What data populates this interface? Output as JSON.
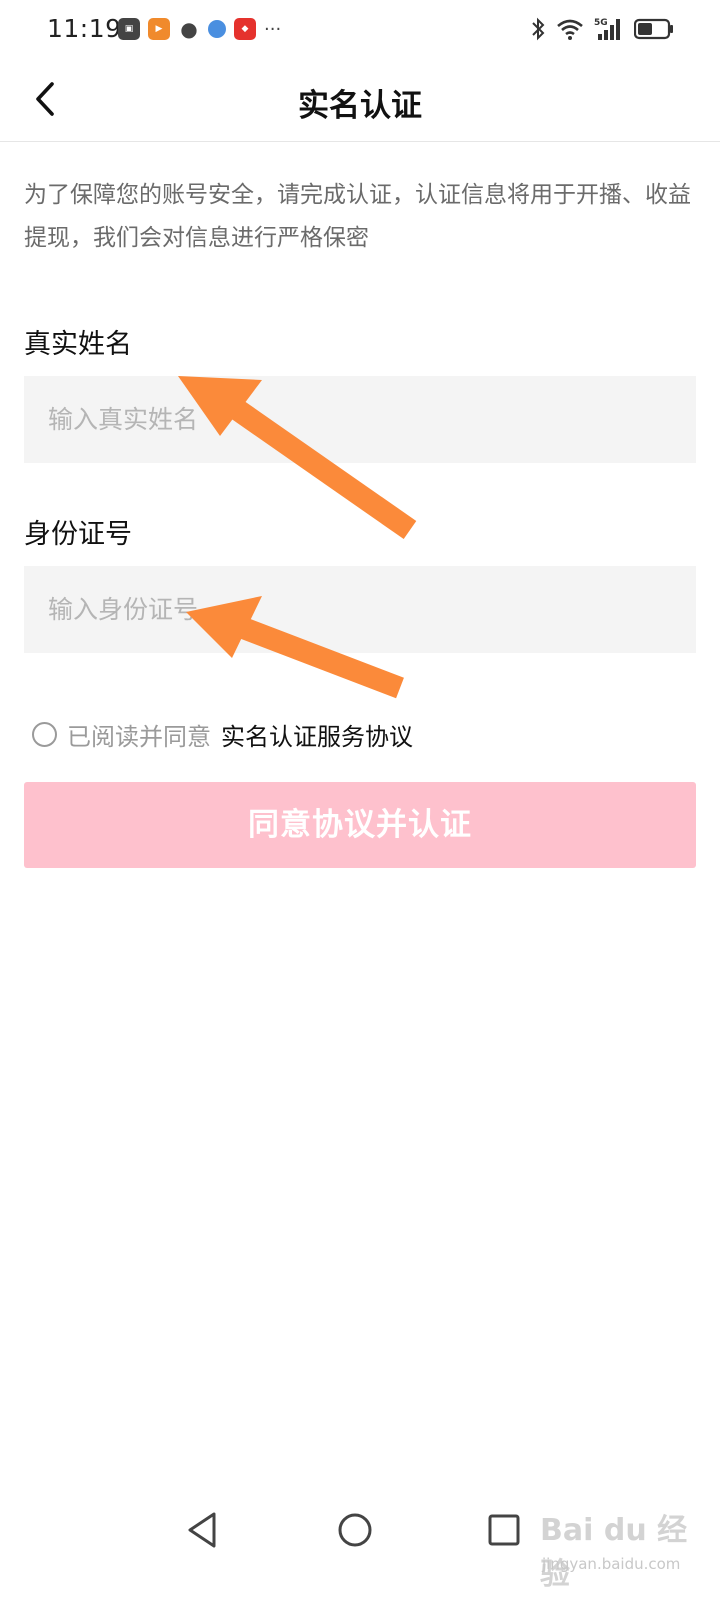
{
  "status_bar": {
    "time": "11:19",
    "more": "···",
    "network": "5G"
  },
  "header": {
    "title": "实名认证"
  },
  "intro_text": "为了保障您的账号安全，请完成认证，认证信息将用于开播、收益提现，我们会对信息进行严格保密",
  "form": {
    "name_label": "真实姓名",
    "name_placeholder": "输入真实姓名",
    "id_label": "身份证号",
    "id_placeholder": "输入身份证号"
  },
  "agreement": {
    "prefix": "已阅读并同意",
    "link": "实名认证服务协议",
    "checked": false
  },
  "submit_label": "同意协议并认证",
  "colors": {
    "submit_bg": "#fec1cd",
    "arrow": "#fb8a3a",
    "input_bg": "#f4f4f4"
  },
  "watermark": {
    "main": "Bai du 经验",
    "sub": "jingyan.baidu.com"
  }
}
